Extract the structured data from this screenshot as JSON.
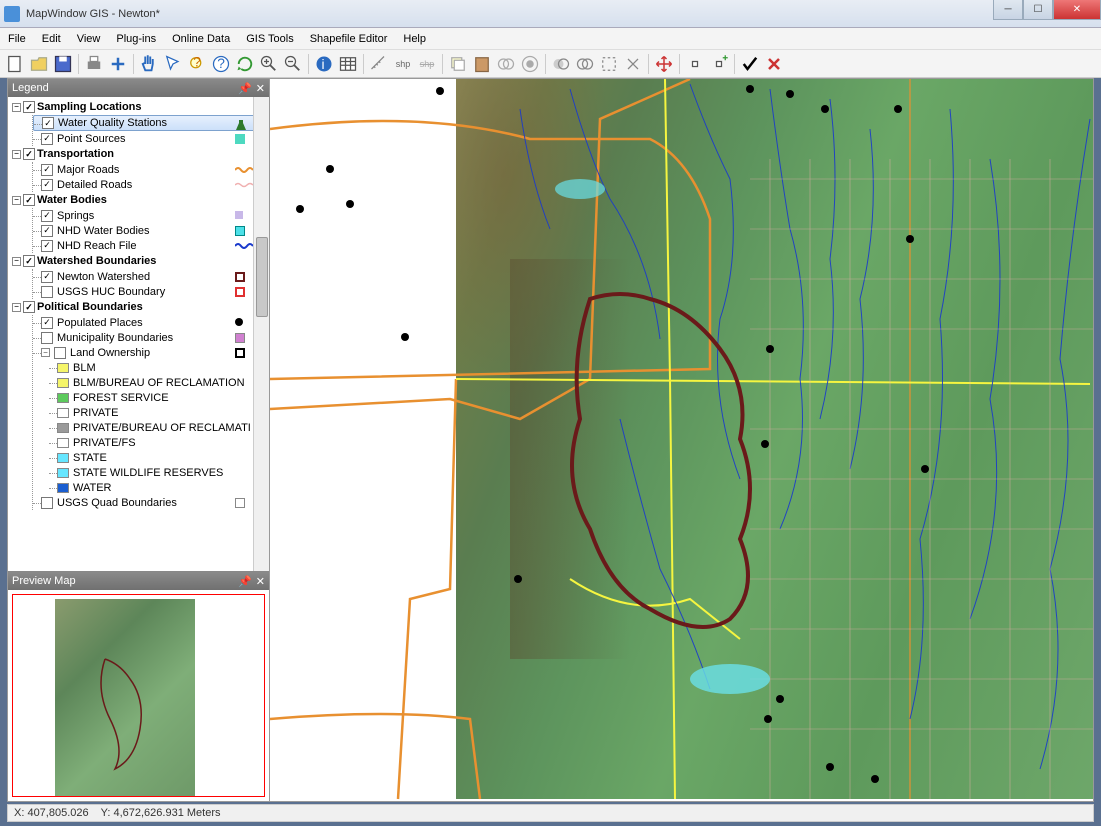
{
  "window": {
    "title": "MapWindow GIS  - Newton*"
  },
  "menu": [
    "File",
    "Edit",
    "View",
    "Plug-ins",
    "Online Data",
    "GIS Tools",
    "Shapefile Editor",
    "Help"
  ],
  "panels": {
    "legend_title": "Legend",
    "preview_title": "Preview Map"
  },
  "legend": [
    {
      "name": "Sampling Locations",
      "expanded": "minus",
      "checked": true,
      "items": [
        {
          "name": "Water Quality Stations",
          "checked": true,
          "sym": "flask",
          "selected": true
        },
        {
          "name": "Point Sources",
          "checked": true,
          "sym": "square-teal"
        }
      ]
    },
    {
      "name": "Transportation",
      "expanded": "minus",
      "checked": true,
      "items": [
        {
          "name": "Major Roads",
          "checked": true,
          "sym": "wave-orange"
        },
        {
          "name": "Detailed Roads",
          "checked": true,
          "sym": "wave-pink"
        }
      ]
    },
    {
      "name": "Water Bodies",
      "expanded": "minus",
      "checked": true,
      "items": [
        {
          "name": "Springs",
          "checked": true,
          "sym": "square-lav"
        },
        {
          "name": "NHD Water Bodies",
          "checked": true,
          "sym": "square-cyan"
        },
        {
          "name": "NHD Reach File",
          "checked": true,
          "sym": "wave-blue"
        }
      ]
    },
    {
      "name": "Watershed Boundaries",
      "expanded": "minus",
      "checked": true,
      "items": [
        {
          "name": "Newton Watershed",
          "checked": true,
          "sym": "box-darkred"
        },
        {
          "name": "USGS HUC Boundary",
          "checked": false,
          "sym": "box-red"
        }
      ]
    },
    {
      "name": "Political Boundaries",
      "expanded": "minus",
      "checked": true,
      "items": [
        {
          "name": "Populated Places",
          "checked": true,
          "sym": "dot-black"
        },
        {
          "name": "Municipality Boundaries",
          "checked": false,
          "sym": "square-mag"
        },
        {
          "name": "Land Ownership",
          "checked": false,
          "expanded": "minus",
          "sym": "box-black",
          "sub": [
            {
              "name": "BLM",
              "color": "#f5f56a"
            },
            {
              "name": "BLM/BUREAU OF RECLAMATION",
              "color": "#f5f56a"
            },
            {
              "name": "FOREST SERVICE",
              "color": "#5dca5d"
            },
            {
              "name": "PRIVATE",
              "color": "#ffffff"
            },
            {
              "name": "PRIVATE/BUREAU OF RECLAMATI",
              "color": "#9a9a9a"
            },
            {
              "name": "PRIVATE/FS",
              "color": "#ffffff"
            },
            {
              "name": "STATE",
              "color": "#66e6ff"
            },
            {
              "name": "STATE WILDLIFE RESERVES",
              "color": "#66e6ff"
            },
            {
              "name": "WATER",
              "color": "#1a5ed0"
            }
          ]
        },
        {
          "name": "USGS Quad Boundaries",
          "checked": false,
          "sym": "box-gray"
        }
      ]
    }
  ],
  "status": {
    "x": "X: 407,805.026",
    "y": "Y: 4,672,626.931 Meters"
  },
  "toolbar_icons": [
    "new",
    "open",
    "save",
    "print",
    "plus",
    "sep",
    "pan",
    "select",
    "identify",
    "help",
    "refresh",
    "zoom-in",
    "zoom-out",
    "sep",
    "info",
    "table",
    "sep",
    "measure",
    "add-shp",
    "rem-shp",
    "sep",
    "copy",
    "paste",
    "union",
    "buffer",
    "sep",
    "clip1",
    "clip2",
    "extent",
    "redraw",
    "sep",
    "move",
    "sep",
    "node",
    "add",
    "sep",
    "check",
    "cross"
  ]
}
